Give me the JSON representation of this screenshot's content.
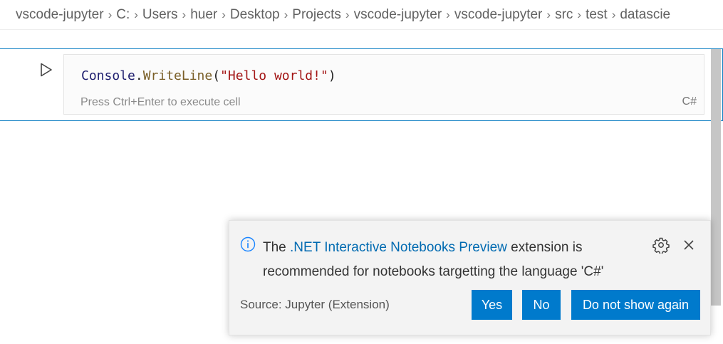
{
  "breadcrumb": {
    "items": [
      "vscode-jupyter",
      "C:",
      "Users",
      "huer",
      "Desktop",
      "Projects",
      "vscode-jupyter",
      "vscode-jupyter",
      "src",
      "test",
      "datascie"
    ]
  },
  "cell": {
    "code": {
      "class_name": "Console",
      "dot": ".",
      "method": "WriteLine",
      "open_paren": "(",
      "string": "\"Hello world!\"",
      "close_paren": ")"
    },
    "hint": "Press Ctrl+Enter to execute cell",
    "language": "C#",
    "run_icon": "play-icon"
  },
  "notification": {
    "icon": "info-icon",
    "message_prefix": "The ",
    "extension_link": ".NET Interactive Notebooks Preview",
    "message_suffix": " extension is recommended for notebooks targetting the language 'C#'",
    "source": "Source: Jupyter (Extension)",
    "buttons": {
      "yes": "Yes",
      "no": "No",
      "dont_show": "Do not show again"
    },
    "gear_icon": "gear-icon",
    "close_icon": "close-icon"
  },
  "colors": {
    "accent": "#007acc",
    "link": "#006ab1",
    "cell_border": "#0a7dc2",
    "info_icon": "#1a85ff"
  }
}
